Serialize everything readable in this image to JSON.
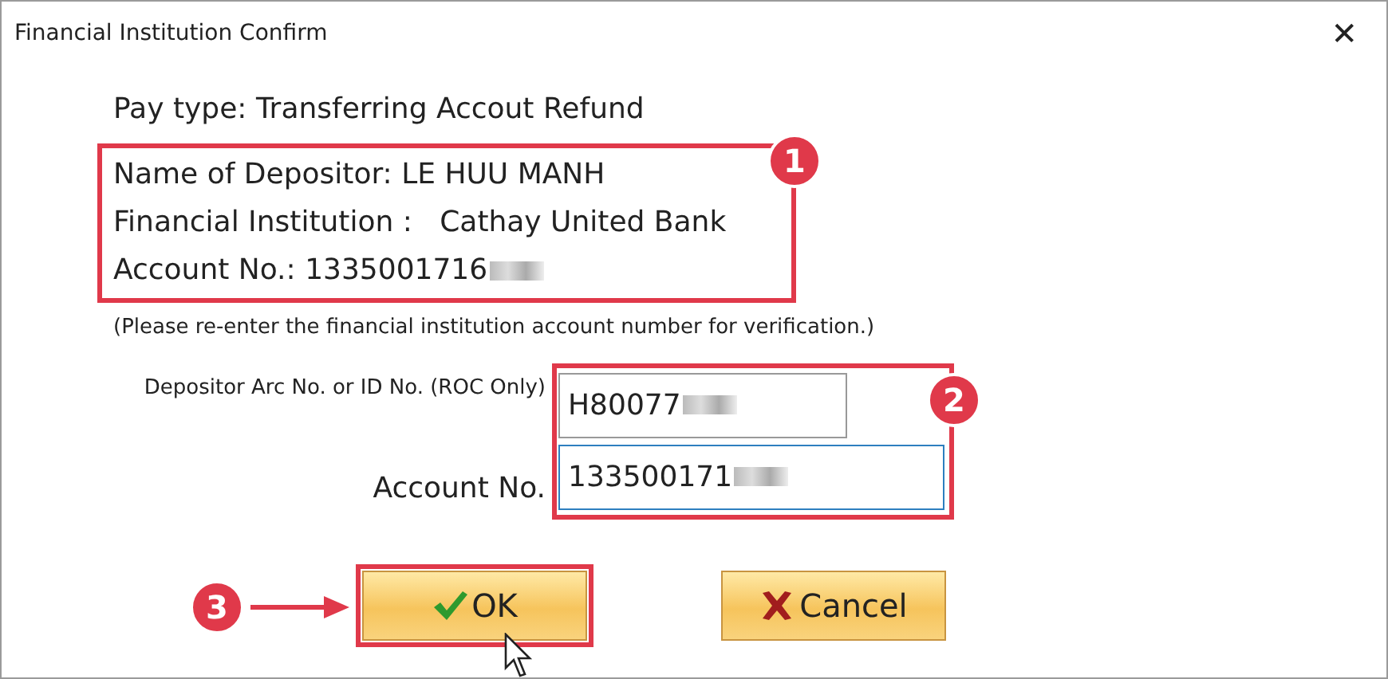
{
  "window": {
    "title": "Financial Institution Confirm",
    "close": "✕"
  },
  "pay_type": "Pay type: Transferring Accout Refund",
  "details": [
    "Name of Depositor: LE HUU MANH",
    "Financial Institution :   Cathay United Bank",
    "Account No.: 1335001716"
  ],
  "note": "(Please re-enter the financial institution account number for verification.)",
  "fields": [
    {
      "label": "Depositor Arc No. or ID No. (ROC Only)",
      "value": "H80077",
      "focused": false
    },
    {
      "label": "Account No.",
      "value": "133500171",
      "focused": true
    }
  ],
  "buttons": [
    {
      "label": "OK",
      "kind": "ok"
    },
    {
      "label": "Cancel",
      "kind": "cancel"
    }
  ],
  "annotations": [
    "1",
    "2",
    "3"
  ]
}
